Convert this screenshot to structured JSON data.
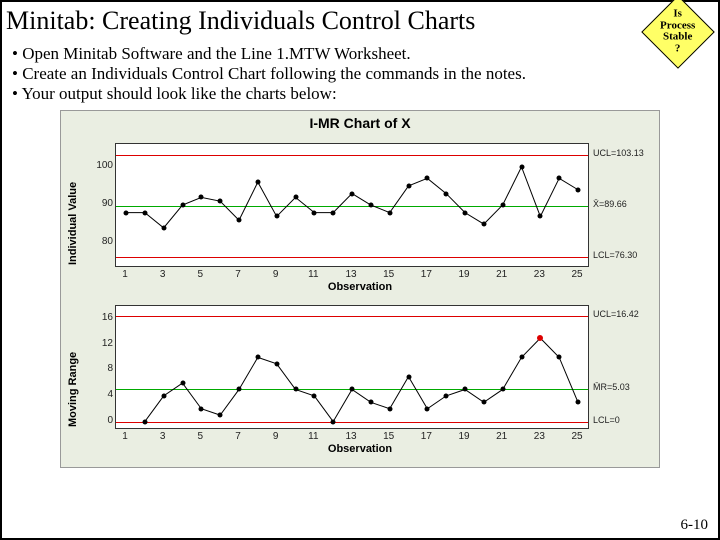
{
  "title": "Minitab: Creating Individuals Control Charts",
  "callout": {
    "l1": "Is",
    "l2": "Process",
    "l3": "Stable",
    "l4": "?"
  },
  "bullets": [
    "• Open Minitab Software and the Line 1.MTW Worksheet.",
    "• Create an Individuals Control Chart following the commands in the notes.",
    "• Your output should look like the charts below:"
  ],
  "footer": "6-10",
  "chart_data": [
    {
      "type": "line",
      "title": "I-MR Chart of X",
      "ylabel": "Individual Value",
      "xlabel": "Observation",
      "x": [
        1,
        2,
        3,
        4,
        5,
        6,
        7,
        8,
        9,
        10,
        11,
        12,
        13,
        14,
        15,
        16,
        17,
        18,
        19,
        20,
        21,
        22,
        23,
        24,
        25
      ],
      "xticks": [
        1,
        3,
        5,
        7,
        9,
        11,
        13,
        15,
        17,
        19,
        21,
        23,
        25
      ],
      "yticks": [
        80,
        90,
        100
      ],
      "ylim": [
        74,
        106
      ],
      "values": [
        88,
        88,
        84,
        90,
        92,
        91,
        86,
        96,
        87,
        92,
        88,
        88,
        93,
        90,
        88,
        95,
        97,
        93,
        88,
        85,
        90,
        100,
        87,
        97,
        94
      ],
      "ucl": 103.13,
      "cl": 89.66,
      "lcl": 76.3,
      "clname": "X̄",
      "right_labels": {
        "ucl": "UCL=103.13",
        "cl": "X̄=89.66",
        "lcl": "LCL=76.30"
      }
    },
    {
      "type": "line",
      "title": "",
      "ylabel": "Moving Range",
      "xlabel": "Observation",
      "x": [
        1,
        2,
        3,
        4,
        5,
        6,
        7,
        8,
        9,
        10,
        11,
        12,
        13,
        14,
        15,
        16,
        17,
        18,
        19,
        20,
        21,
        22,
        23,
        24,
        25
      ],
      "xticks": [
        1,
        3,
        5,
        7,
        9,
        11,
        13,
        15,
        17,
        19,
        21,
        23,
        25
      ],
      "yticks": [
        0,
        4,
        8,
        12,
        16
      ],
      "ylim": [
        -1,
        18
      ],
      "values": [
        null,
        0,
        4,
        6,
        2,
        1,
        5,
        10,
        9,
        5,
        4,
        0,
        5,
        3,
        2,
        7,
        2,
        4,
        5,
        3,
        5,
        10,
        13,
        10,
        3
      ],
      "outliers": [
        23
      ],
      "ucl": 16.42,
      "cl": 5.03,
      "lcl": 0,
      "clname": "M̄R",
      "right_labels": {
        "ucl": "UCL=16.42",
        "cl": "M̄R=5.03",
        "lcl": "LCL=0"
      }
    }
  ]
}
